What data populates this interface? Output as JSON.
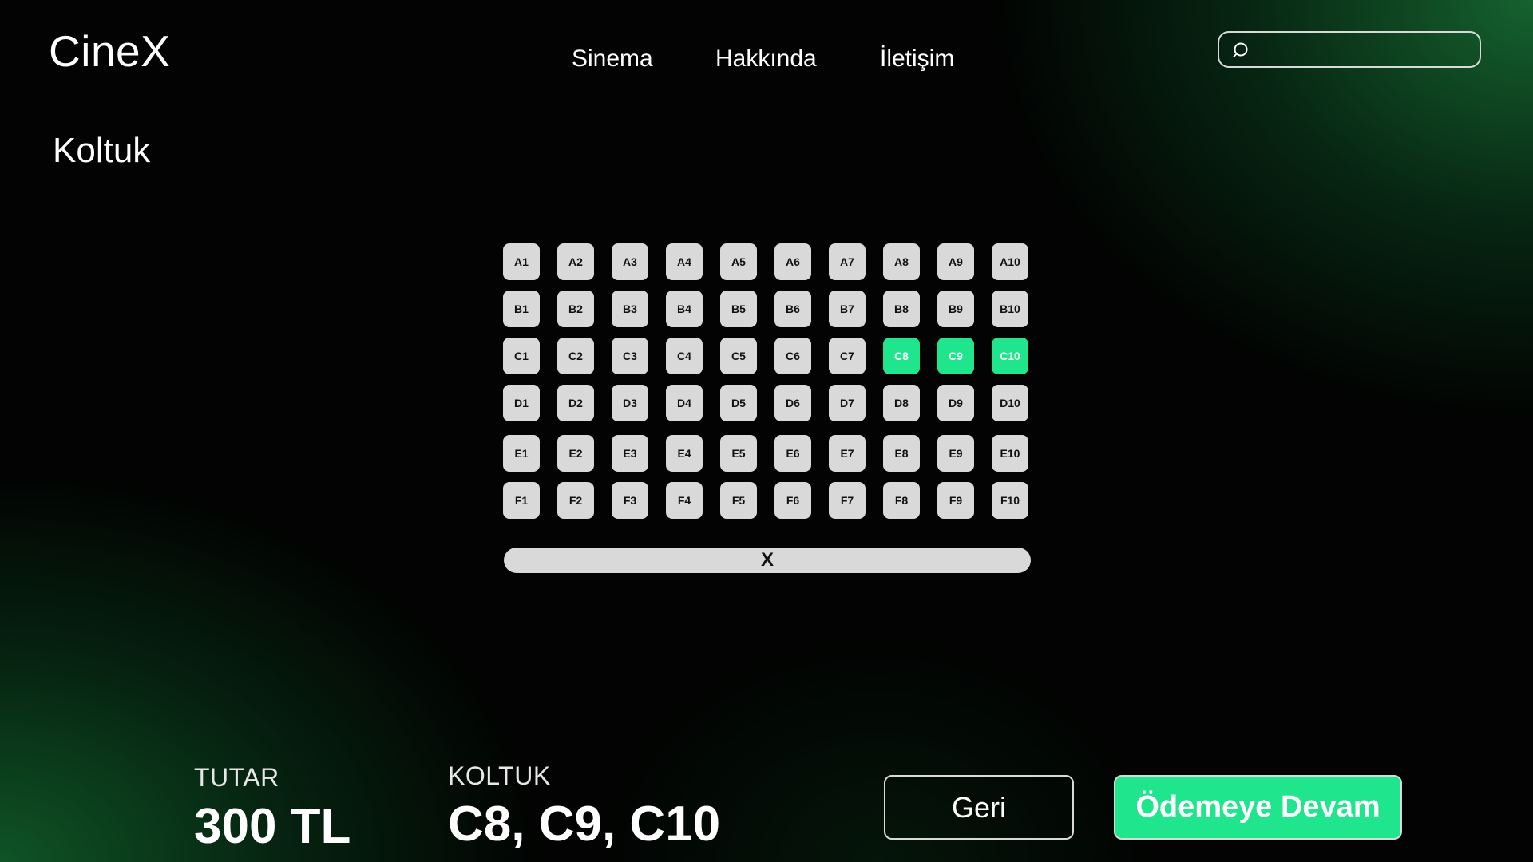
{
  "header": {
    "logo": "CineX",
    "nav": [
      "Sinema",
      "Hakkında",
      "İletişim"
    ],
    "search": {
      "placeholder": "",
      "value": ""
    }
  },
  "page_title": "Koltuk",
  "seat_map": {
    "rows": [
      [
        "A1",
        "A2",
        "A3",
        "A4",
        "A5",
        "A6",
        "A7",
        "A8",
        "A9",
        "A10"
      ],
      [
        "B1",
        "B2",
        "B3",
        "B4",
        "B5",
        "B6",
        "B7",
        "B8",
        "B9",
        "B10"
      ],
      [
        "C1",
        "C2",
        "C3",
        "C4",
        "C5",
        "C6",
        "C7",
        "C8",
        "C9",
        "C10"
      ],
      [
        "D1",
        "D2",
        "D3",
        "D4",
        "D5",
        "D6",
        "D7",
        "D8",
        "D9",
        "D10"
      ],
      [
        "E1",
        "E2",
        "E3",
        "E4",
        "E5",
        "E6",
        "E7",
        "E8",
        "E9",
        "E10"
      ],
      [
        "F1",
        "F2",
        "F3",
        "F4",
        "F5",
        "F6",
        "F7",
        "F8",
        "F9",
        "F10"
      ]
    ],
    "selected": [
      "C8",
      "C9",
      "C10"
    ],
    "screen_label": "X"
  },
  "summary": {
    "amount_label": "TUTAR",
    "amount_value": "300 TL",
    "seats_label": "KOLTUK",
    "seats_value": "C8, C9, C10"
  },
  "actions": {
    "back_label": "Geri",
    "continue_label": "Ödemeye Devam"
  },
  "colors": {
    "accent": "#1fe58c",
    "seat_available": "#d9d9d9",
    "background": "#020302",
    "gradient_green": "#15622f"
  }
}
